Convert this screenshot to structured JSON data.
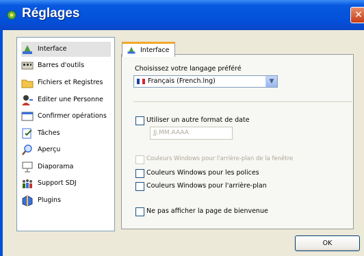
{
  "window": {
    "title": "Réglages",
    "close_glyph": "✕"
  },
  "sidebar": {
    "items": [
      {
        "label": "Interface",
        "icon": "interface-icon",
        "selected": true
      },
      {
        "label": "Barres d'outils",
        "icon": "toolbar-icon"
      },
      {
        "label": "Fichiers et Registres",
        "icon": "folder-icon"
      },
      {
        "label": "Editer une Personne",
        "icon": "person-icon"
      },
      {
        "label": "Confirmer opérations",
        "icon": "confirm-icon"
      },
      {
        "label": "Tâches",
        "icon": "tasks-icon"
      },
      {
        "label": "Aperçu",
        "icon": "preview-icon"
      },
      {
        "label": "Diaporama",
        "icon": "slideshow-icon"
      },
      {
        "label": "Support SDJ",
        "icon": "support-icon"
      },
      {
        "label": "Plugins",
        "icon": "plugins-icon"
      }
    ]
  },
  "tab": {
    "label": "Interface"
  },
  "language": {
    "label": "Choisissez votre langage préféré",
    "selected": "Français (French.lng)"
  },
  "date_format": {
    "label": "Utiliser un autre format de date",
    "placeholder": "JJ.MM.AAAA",
    "checked": false
  },
  "colors": {
    "window_bg": {
      "label": "Couleurs Windows pour l'arrière-plan de la fenêtre",
      "enabled": false,
      "checked": false
    },
    "fonts": {
      "label": "Couleurs Windows pour les polices",
      "checked": false
    },
    "background": {
      "label": "Couleurs Windows pour l'arrière-plan",
      "checked": false
    }
  },
  "welcome": {
    "label": "Ne pas afficher la page de bienvenue",
    "checked": false
  },
  "ok_button": {
    "label": "OK"
  }
}
